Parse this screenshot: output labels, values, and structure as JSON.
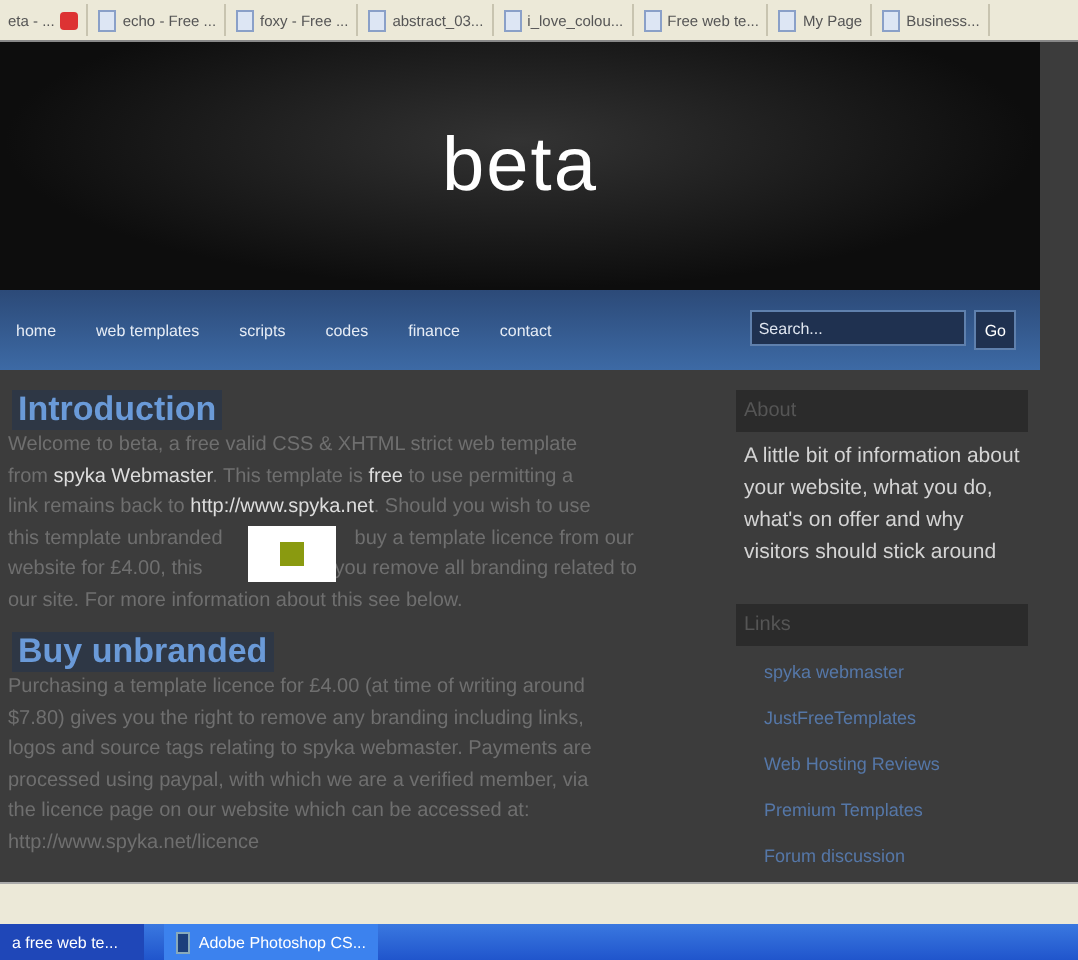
{
  "browser_tabs": [
    {
      "label": "eta - ..."
    },
    {
      "label": "echo - Free ..."
    },
    {
      "label": "foxy - Free ..."
    },
    {
      "label": "abstract_03..."
    },
    {
      "label": "i_love_colou..."
    },
    {
      "label": "Free web te..."
    },
    {
      "label": "My Page"
    },
    {
      "label": "Business..."
    }
  ],
  "site": {
    "title": "beta",
    "nav": [
      "home",
      "web templates",
      "scripts",
      "codes",
      "finance",
      "contact"
    ],
    "search": {
      "placeholder": "Search...",
      "button": "Go"
    }
  },
  "sections": [
    {
      "heading": "Introduction",
      "lines": [
        {
          "text": "Welcome to beta, a free valid CSS & XHTML strict web template"
        },
        {
          "text": "from **spyka Webmaster**. This template is **free** to use permitting a"
        },
        {
          "text": "link remains back to **http://www.spyka.net**. Should you wish to use"
        },
        {
          "text": "this template unbranded",
          "after": "buy a template licence from our"
        },
        {
          "text": "website for £4.00, this",
          "after": "you remove all branding related to"
        },
        {
          "text": "our site. For more information about this see below."
        }
      ]
    },
    {
      "heading": "Buy unbranded",
      "lines": [
        {
          "text": "Purchasing a template licence for £4.00 (at time of writing around"
        },
        {
          "text": "$7.80) gives you the right to remove any branding including links,"
        },
        {
          "text": "logos and source tags relating to spyka webmaster. Payments are"
        },
        {
          "text": "processed using paypal, with which we are a verified member, via"
        },
        {
          "text": "the licence page on our website which can be accessed at:"
        },
        {
          "text": "http://www.spyka.net/licence"
        }
      ]
    }
  ],
  "sidebar": {
    "about": {
      "heading": "About",
      "text": "A little bit of information about your website, what you do, what's on offer and why visitors should stick around"
    },
    "links": {
      "heading": "Links",
      "items": [
        "spyka webmaster",
        "JustFreeTemplates",
        "Web Hosting Reviews",
        "Premium Templates",
        "Forum discussion"
      ]
    }
  },
  "taskbar": [
    "a free web te...",
    "Adobe Photoshop CS..."
  ]
}
